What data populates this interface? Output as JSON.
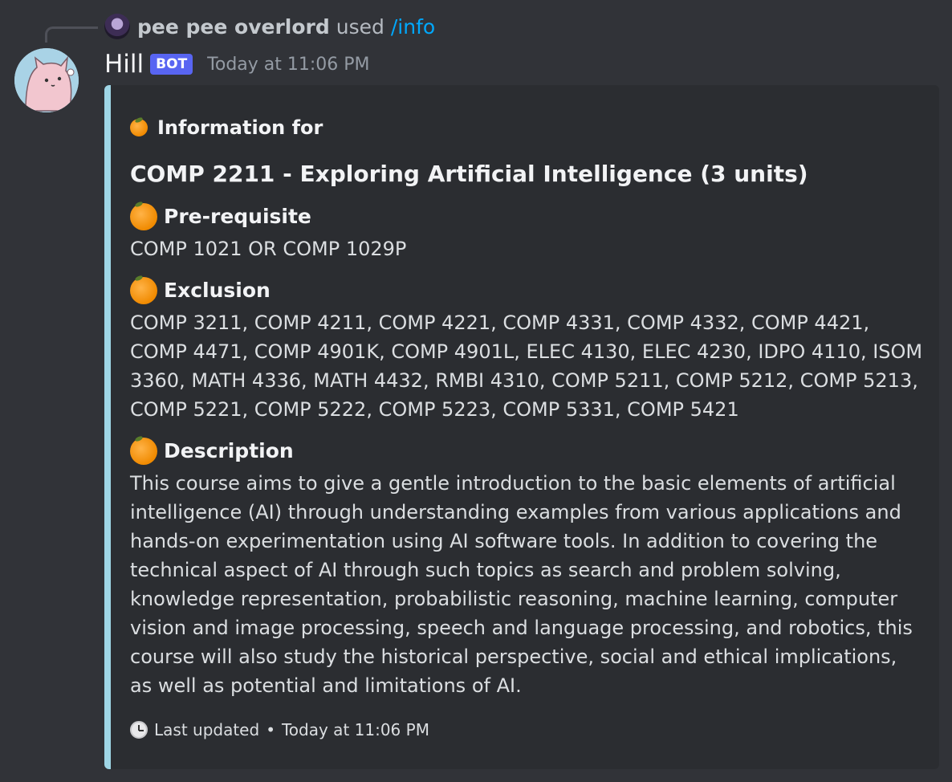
{
  "reply": {
    "user": "pee pee overlord",
    "verb": "used",
    "command": "/info"
  },
  "message": {
    "author": "Hill",
    "bot_tag": "BOT",
    "timestamp": "Today at 11:06 PM"
  },
  "embed": {
    "accent_color": "#9fd6e6",
    "author_icon": "tangerine-icon",
    "author": "Information for",
    "title": "COMP 2211 - Exploring Artificial Intelligence (3 units)",
    "fields": [
      {
        "name": "Pre-requisite",
        "value": "COMP 1021 OR COMP 1029P"
      },
      {
        "name": "Exclusion",
        "value": "COMP 3211, COMP 4211, COMP 4221, COMP 4331, COMP 4332, COMP 4421, COMP 4471, COMP 4901K, COMP 4901L, ELEC 4130, ELEC 4230, IDPO 4110, ISOM 3360, MATH 4336, MATH 4432, RMBI 4310, COMP 5211, COMP 5212, COMP 5213, COMP 5221, COMP 5222, COMP 5223, COMP 5331, COMP 5421"
      },
      {
        "name": "Description",
        "value": "This course aims to give a gentle introduction to the basic elements of artificial intelligence (AI) through understanding examples from various applications and hands-on experimentation using AI software tools. In addition to covering the technical aspect of AI through such topics as search and problem solving, knowledge representation, probabilistic reasoning, machine learning, computer vision and image processing, speech and language processing, and robotics, this course will also study the historical perspective, social and ethical implications, as well as potential and limitations of AI."
      }
    ],
    "footer": {
      "icon": "clock-icon",
      "text": "Last updated",
      "separator": "•",
      "timestamp": "Today at 11:06 PM"
    }
  },
  "colors": {
    "background": "#313338",
    "embed_background": "#2b2d31",
    "bot_tag": "#5865f2",
    "command_link": "#00a8fc"
  }
}
